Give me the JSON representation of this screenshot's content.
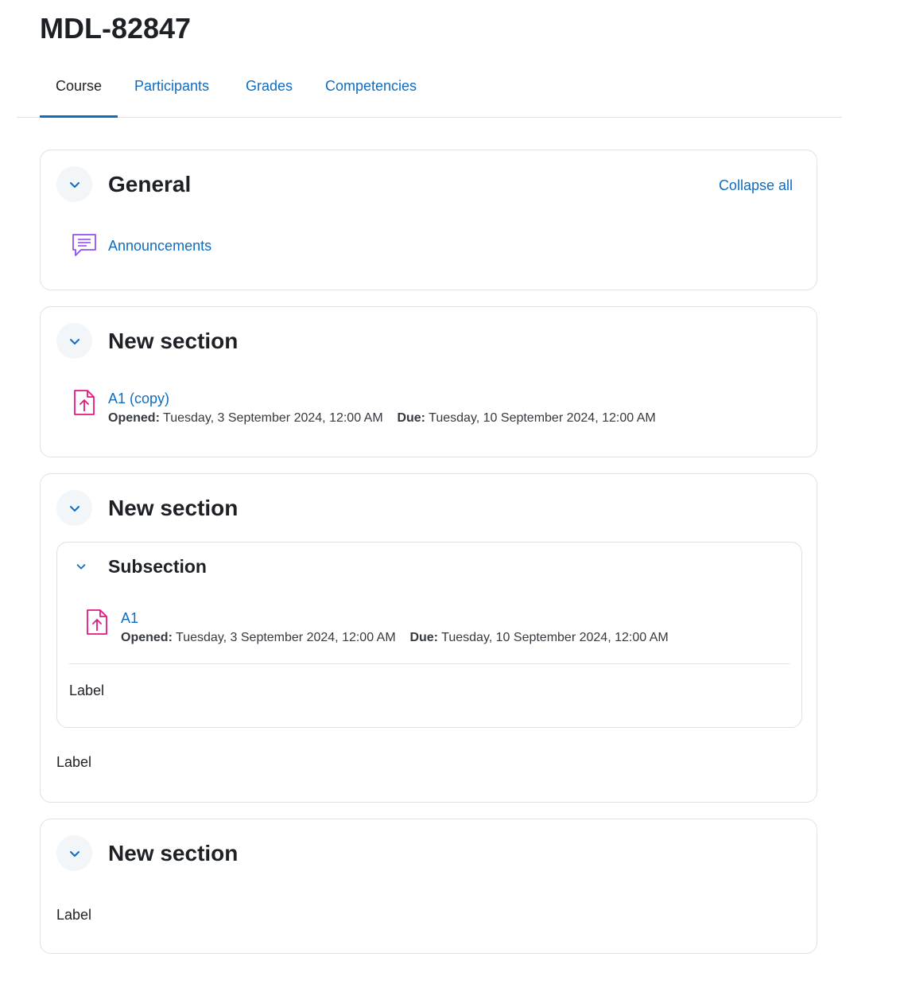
{
  "page": {
    "title": "MDL-82847"
  },
  "tabs": [
    {
      "label": "Course",
      "active": true
    },
    {
      "label": "Participants",
      "active": false
    },
    {
      "label": "Grades",
      "active": false
    },
    {
      "label": "Competencies",
      "active": false
    }
  ],
  "colors": {
    "link": "#0f6cbf",
    "forum_icon": "#8f50f4",
    "assign_icon": "#e4187e",
    "border": "#dee2e6"
  },
  "sections": [
    {
      "title": "General",
      "collapse_all_label": "Collapse all",
      "activities": [
        {
          "icon": "forum-icon",
          "name": "Announcements"
        }
      ]
    },
    {
      "title": "New section",
      "activities": [
        {
          "icon": "assignment-upload-icon",
          "name": "A1 (copy)",
          "opened_label": "Opened:",
          "opened_value": "Tuesday, 3 September 2024, 12:00 AM",
          "due_label": "Due:",
          "due_value": "Tuesday, 10 September 2024, 12:00 AM"
        }
      ]
    },
    {
      "title": "New section",
      "subsection": {
        "title": "Subsection",
        "activity": {
          "icon": "assignment-upload-icon",
          "name": "A1",
          "opened_label": "Opened:",
          "opened_value": "Tuesday, 3 September 2024, 12:00 AM",
          "due_label": "Due:",
          "due_value": "Tuesday, 10 September 2024, 12:00 AM"
        },
        "label": "Label"
      },
      "label": "Label"
    },
    {
      "title": "New section",
      "label": "Label"
    }
  ]
}
